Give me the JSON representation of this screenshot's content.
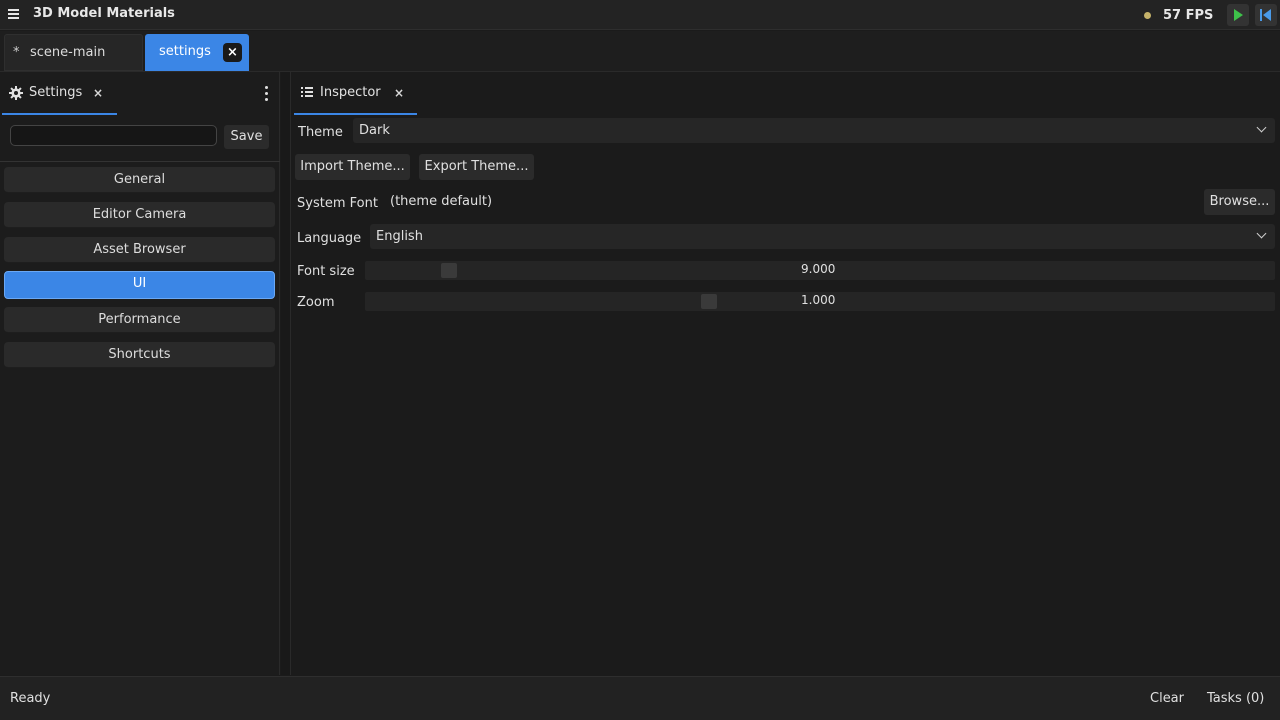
{
  "app": {
    "title": "3D Model Materials",
    "fps": "57 FPS"
  },
  "doc_tabs": [
    {
      "modified_marker": "*",
      "label": "scene-main"
    },
    {
      "label": "settings",
      "close": "×"
    }
  ],
  "left_panel": {
    "tab": {
      "label": "Settings",
      "close": "×"
    },
    "search": {
      "value": "",
      "placeholder": ""
    },
    "save_label": "Save",
    "nav": [
      "General",
      "Editor Camera",
      "Asset Browser",
      "UI",
      "Performance",
      "Shortcuts"
    ],
    "active_nav": "UI"
  },
  "inspector": {
    "tab": {
      "label": "Inspector",
      "close": "×"
    },
    "theme": {
      "label": "Theme",
      "value": "Dark"
    },
    "import_label": "Import Theme...",
    "export_label": "Export Theme...",
    "system_font": {
      "label": "System Font",
      "value": "(theme default)",
      "browse_label": "Browse..."
    },
    "language": {
      "label": "Language",
      "value": "English"
    },
    "font_size": {
      "label": "Font size",
      "value": "9.000"
    },
    "zoom": {
      "label": "Zoom",
      "value": "1.000"
    }
  },
  "statusbar": {
    "status": "Ready",
    "clear_label": "Clear",
    "tasks_label": "Tasks (0)"
  },
  "colors": {
    "accent": "#3b86e6",
    "play": "#3ec24a",
    "skip": "#4a9ae8",
    "status_dot": "#c5b26a"
  },
  "icons": [
    "menu-icon",
    "play-icon",
    "skip-back-icon",
    "gear-icon",
    "kebab-menu-icon",
    "list-icon",
    "close-icon",
    "chevron-down-icon"
  ]
}
